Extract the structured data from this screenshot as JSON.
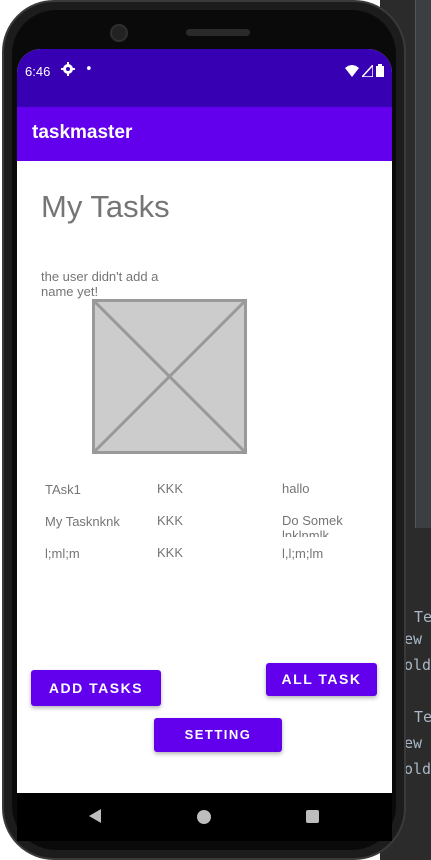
{
  "status_bar": {
    "time": "6:46",
    "gear_icon": "settings-icon",
    "dot": "•"
  },
  "app_bar": {
    "title": "taskmaster"
  },
  "main": {
    "page_title": "My Tasks",
    "user_name": "the user didn't add a name yet!",
    "image_icon": "image-placeholder-icon"
  },
  "tasks": [
    {
      "title": "TAsk1",
      "body": "KKK",
      "state": "hallo"
    },
    {
      "title": "My Tasknknk",
      "body": "KKK",
      "state": "Do Somek lnklnmlk"
    },
    {
      "title": "l;ml;m",
      "body": "KKK",
      "state": "l,l;m;lm"
    }
  ],
  "buttons": {
    "add_tasks": "ADD TASKS",
    "all_task": "ALL TASK",
    "setting": "SETTING"
  },
  "colors": {
    "status_bar": "#3700b3",
    "app_bar": "#6200ee",
    "button": "#6200ee"
  }
}
